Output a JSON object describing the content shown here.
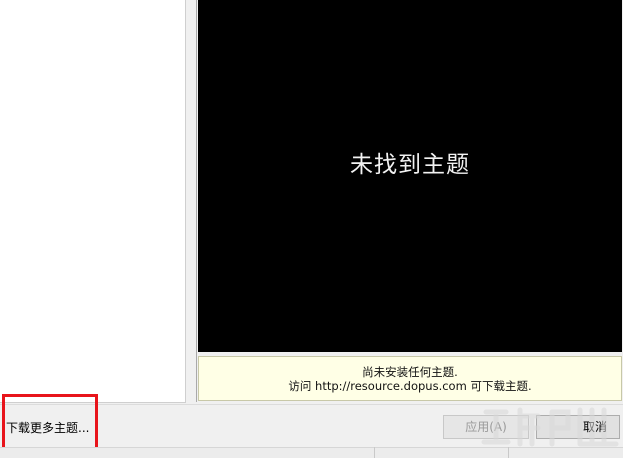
{
  "preview": {
    "title": "未找到主题"
  },
  "info": {
    "line1": "尚未安装任何主题.",
    "line2": "访问 http://resource.dopus.com 可下载主题."
  },
  "footer": {
    "download_link": "下载更多主题...",
    "apply_label": "应用(A)",
    "cancel_label": "取消"
  },
  "colors": {
    "highlight": "#e8141b",
    "preview_bg": "#000000",
    "info_bg": "#ffffe6"
  },
  "icons": {
    "watermark": "site-logo-watermark"
  }
}
